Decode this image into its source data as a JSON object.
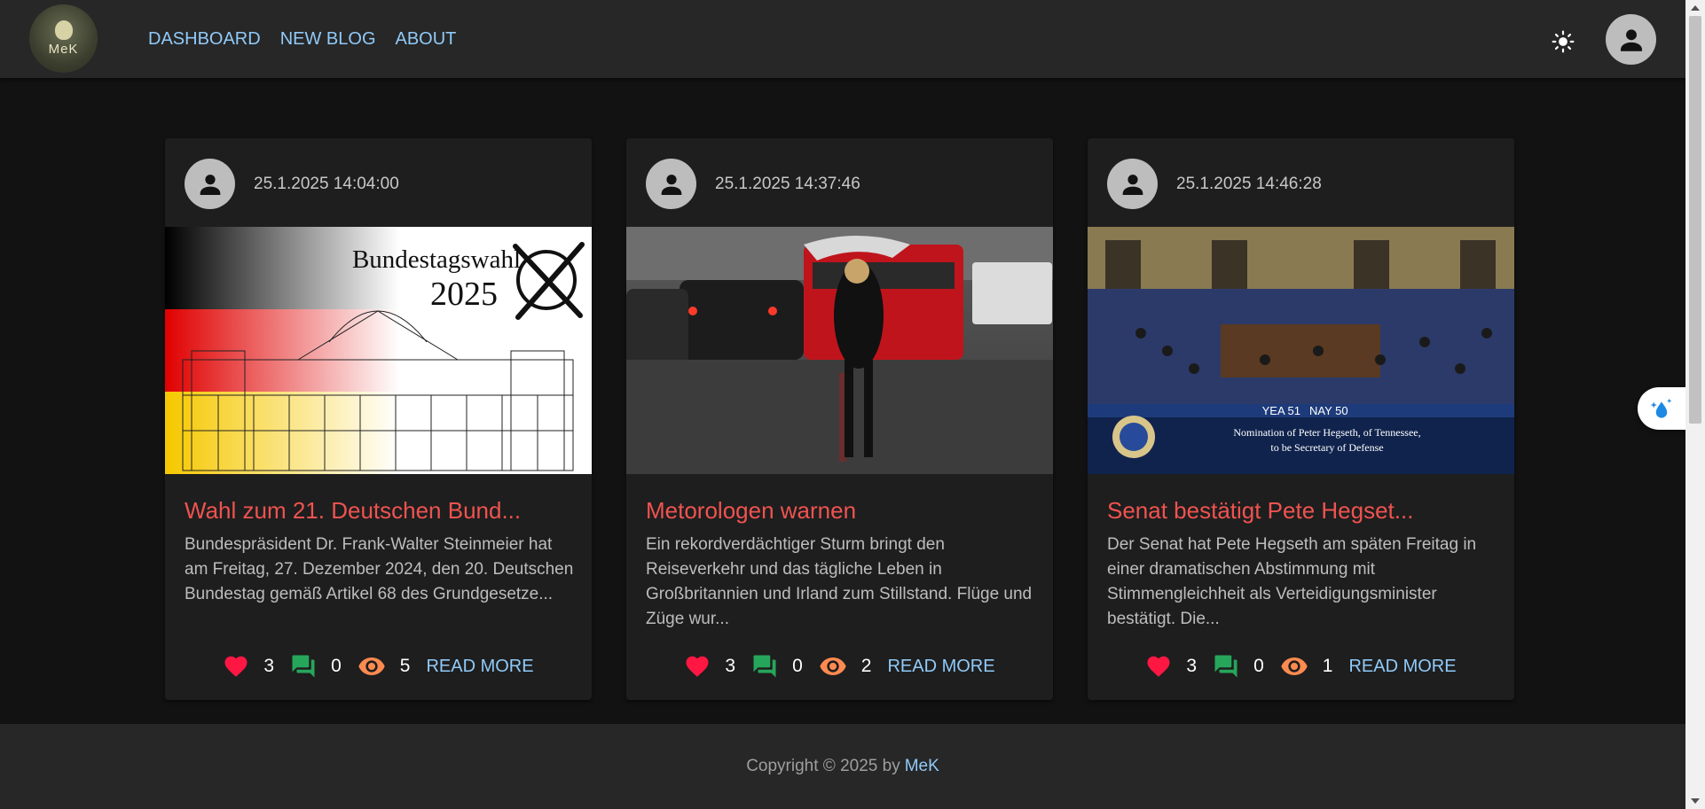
{
  "logo": {
    "text": "MeK"
  },
  "nav": {
    "items": [
      "DASHBOARD",
      "NEW BLOG",
      "ABOUT"
    ]
  },
  "posts": [
    {
      "date": "25.1.2025 14:04:00",
      "image": {
        "text_line1": "Bundestagswahl",
        "text_line2": "2025"
      },
      "title": "Wahl zum 21. Deutschen Bund...",
      "excerpt": "Bundespräsident Dr. Frank-Walter Steinmeier hat am Freitag, 27. Dezember 2024, den 20. Deutschen Bundestag gemäß Artikel 68 des Grundgesetze...",
      "likes": "3",
      "comments": "0",
      "views": "5",
      "read_more": "READ MORE"
    },
    {
      "date": "25.1.2025 14:37:46",
      "title": "Metorologen warnen",
      "excerpt": "Ein rekordverdächtiger Sturm bringt den Reiseverkehr und das tägliche Leben in Großbritannien und Irland zum Stillstand. Flüge und Züge wur...",
      "likes": "3",
      "comments": "0",
      "views": "2",
      "read_more": "READ MORE"
    },
    {
      "date": "25.1.2025 14:46:28",
      "image": {
        "vote_yea": "YEA 51",
        "vote_nay": "NAY 50",
        "caption1": "Nomination of Peter Hegseth, of Tennessee,",
        "caption2": "to be Secretary of Defense"
      },
      "title": "Senat bestätigt Pete Hegset...",
      "excerpt": "Der Senat hat Pete Hegseth am späten Freitag in einer dramatischen Abstimmung mit Stimmengleichheit als Verteidigungsminister bestätigt. Die...",
      "likes": "3",
      "comments": "0",
      "views": "1",
      "read_more": "READ MORE"
    }
  ],
  "footer": {
    "copyright": "Copyright © 2025 by",
    "author": "MeK"
  },
  "colors": {
    "accent": "#90caf9",
    "title": "#ef5350",
    "like": "#ff1744",
    "comment": "#26a65b",
    "view": "#ff8a50"
  }
}
